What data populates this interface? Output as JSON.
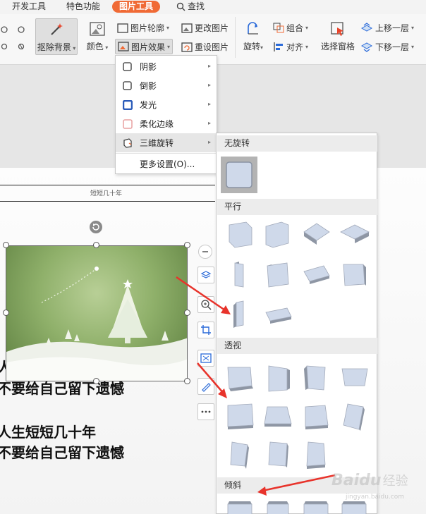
{
  "tabs": {
    "dev": "开发工具",
    "special": "特色功能",
    "picture_tools": "图片工具",
    "search": "查找"
  },
  "ribbon": {
    "remove_bg": "抠除背景",
    "color": "颜色",
    "picture_outline": "图片轮廓",
    "picture_effects": "图片效果",
    "change_picture": "更改图片",
    "reset_picture": "重设图片",
    "rotate": "旋转",
    "group": "组合",
    "align": "对齐",
    "selection_pane": "选择窗格",
    "bring_forward": "上移一层",
    "send_backward": "下移一层"
  },
  "effects_menu": {
    "items": [
      {
        "label": "阴影",
        "icon": "shadow-icon"
      },
      {
        "label": "倒影",
        "icon": "reflection-icon"
      },
      {
        "label": "发光",
        "icon": "glow-icon"
      },
      {
        "label": "柔化边缘",
        "icon": "soft-edges-icon"
      },
      {
        "label": "三维旋转",
        "icon": "3d-rotation-icon"
      }
    ],
    "more": "更多设置(O)..."
  },
  "rotation_submenu": {
    "no_rotation": "无旋转",
    "parallel": "平行",
    "perspective": "透视",
    "oblique": "倾斜"
  },
  "document": {
    "header": "短短几十年",
    "line1": "人生短短几十年",
    "line2": "不要给自己留下遗憾",
    "partial1": "人",
    "partial2": "不要给自己留下遗憾"
  },
  "watermark": {
    "brand": "Baidu",
    "suffix": "经验",
    "url": "jingyan.baidu.com"
  },
  "colors": {
    "accent": "#f06a35",
    "arrow": "#e8332b",
    "tile_face": "#cfd9ea"
  }
}
